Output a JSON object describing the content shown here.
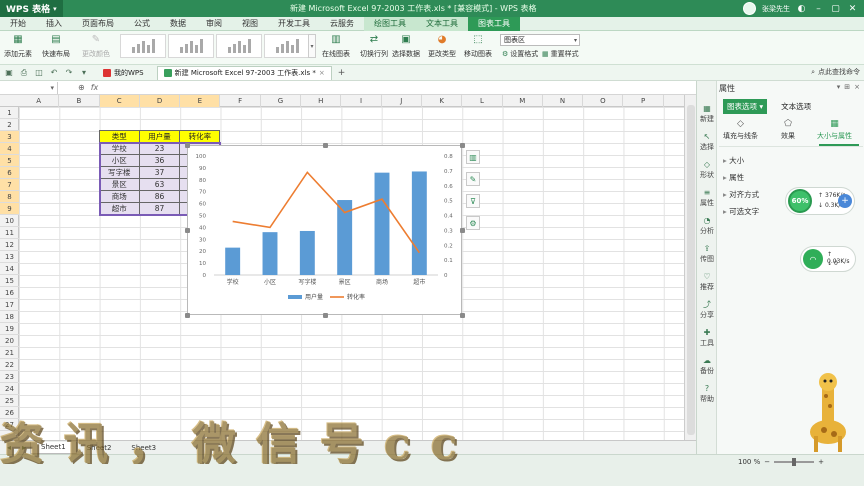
{
  "app": {
    "logo": "WPS 表格",
    "window_title": "新建 Microsoft Excel 97-2003 工作表.xls * [兼容模式] - WPS 表格",
    "user": "张梁先生"
  },
  "menu_tabs": [
    "开始",
    "插入",
    "页面布局",
    "公式",
    "数据",
    "审阅",
    "视图",
    "开发工具",
    "云服务",
    "绘图工具",
    "文本工具",
    "图表工具"
  ],
  "ribbon": {
    "add_element": "添加元素",
    "quick_layout": "快速布局",
    "change_color": "更改颜色",
    "online_chart": "在线图表",
    "switch_row_col": "切换行列",
    "select_data": "选择数据",
    "change_type": "更改类型",
    "move_chart": "移动图表",
    "chart_area": "图表区",
    "set_format": "设置格式",
    "reset_style": "重置样式"
  },
  "doc_tabs": [
    "我的WPS",
    "新建 Microsoft Excel 97-2003 工作表.xls *"
  ],
  "search_cmd": "点此查找命令",
  "formula": {
    "fx": "fx"
  },
  "columns": [
    "A",
    "B",
    "C",
    "D",
    "E",
    "F",
    "G",
    "H",
    "I",
    "J",
    "K",
    "L",
    "M",
    "N",
    "O",
    "P"
  ],
  "rows": [
    "1",
    "2",
    "3",
    "4",
    "5",
    "6",
    "7",
    "8",
    "9",
    "10",
    "11",
    "12",
    "13",
    "14",
    "15",
    "16",
    "17",
    "18",
    "19",
    "20",
    "21",
    "22",
    "23",
    "24",
    "25",
    "26",
    "27"
  ],
  "table": {
    "headers": [
      "类型",
      "用户量",
      "转化率"
    ],
    "rows": [
      [
        "学校",
        "23"
      ],
      [
        "小区",
        "36"
      ],
      [
        "写字楼",
        "37"
      ],
      [
        "景区",
        "63"
      ],
      [
        "商场",
        "86"
      ],
      [
        "超市",
        "87"
      ]
    ]
  },
  "chart_data": {
    "type": "bar",
    "categories": [
      "学校",
      "小区",
      "写字楼",
      "景区",
      "商场",
      "超市"
    ],
    "series": [
      {
        "name": "用户量",
        "type": "bar",
        "axis": "left",
        "values": [
          23,
          36,
          37,
          63,
          86,
          87
        ],
        "color": "#5b9bd5"
      },
      {
        "name": "转化率",
        "type": "line",
        "axis": "right",
        "values": [
          0.36,
          0.32,
          0.69,
          0.42,
          0.51,
          0.15
        ],
        "color": "#ed7d31"
      }
    ],
    "ylim": [
      0,
      100
    ],
    "yticks": [
      "0",
      "10",
      "20",
      "30",
      "40",
      "50",
      "60",
      "70",
      "80",
      "90",
      "100"
    ],
    "y2lim": [
      0,
      0.8
    ],
    "y2ticks": [
      "0",
      "0.1",
      "0.2",
      "0.3",
      "0.4",
      "0.5",
      "0.6",
      "0.7",
      "0.8"
    ],
    "legend": "bottom",
    "grid": false
  },
  "sheets": [
    "Sheet1",
    "Sheet2",
    "Sheet3"
  ],
  "status": {
    "zoom": "100 %"
  },
  "props": {
    "title": "属性",
    "tabs": [
      "图表选项",
      "文本选项"
    ],
    "sub_tabs": [
      "填充与线条",
      "效果",
      "大小与属性"
    ],
    "rows": [
      "大小",
      "属性",
      "对齐方式",
      "可选文字"
    ],
    "rail": [
      "新建",
      "选择",
      "形状",
      "属性",
      "分析",
      "传图",
      "推荐",
      "分享",
      "工具",
      "备份",
      "帮助"
    ]
  },
  "net": {
    "percent": "60%",
    "up": "376K/s",
    "down": "0.3K/s",
    "wifi_up": "0.03K/s",
    "wifi_down": "0"
  },
  "watermark": "资讯，微信号cc"
}
